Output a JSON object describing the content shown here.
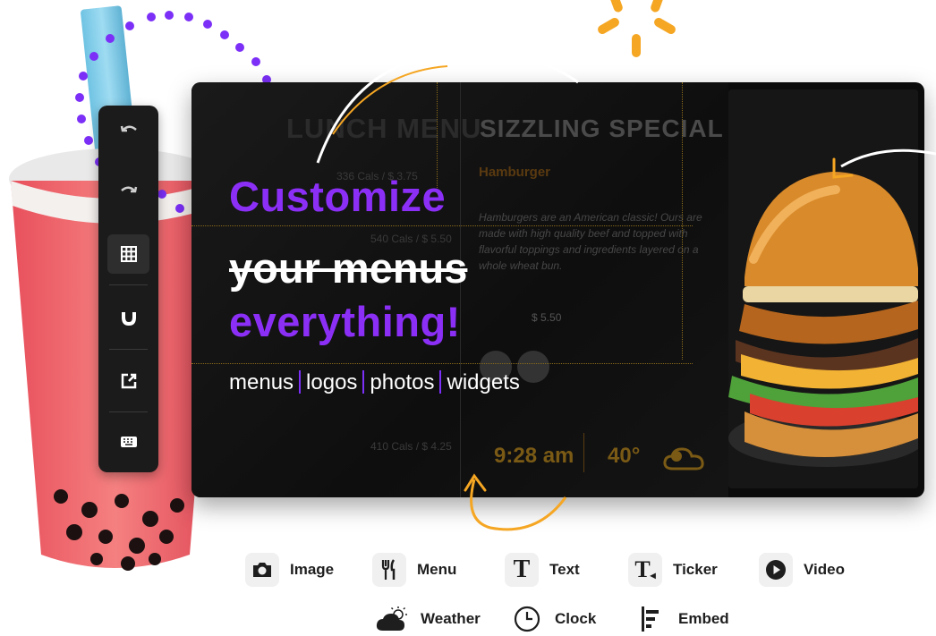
{
  "headline": {
    "line1": "Customize",
    "line2": "your menus",
    "line3": "everything!"
  },
  "features": [
    "menus",
    "logos",
    "photos",
    "widgets"
  ],
  "preview": {
    "lunch_menu_title": "LUNCH MENU",
    "special_title": "SIZZLING SPECIAL",
    "item_name": "Hamburger",
    "item_description": "Hamburgers are an American classic! Ours are made with high quality beef and topped with flavorful toppings and ingredients layered on a whole wheat bun.",
    "item_price": "$ 5.50",
    "menu_rows": [
      {
        "cals": "336 Cals",
        "price": "$ 3.75"
      },
      {
        "cals": "540 Cals",
        "price": "$ 5.50"
      },
      {
        "cals": "410 Cals",
        "price": "$ 4.25"
      }
    ],
    "clock": "9:28 am",
    "temperature": "40°"
  },
  "toolbar": {
    "tools": [
      "undo-icon",
      "redo-icon",
      "grid-icon",
      "magnet-icon",
      "external-link-icon",
      "keyboard-icon"
    ],
    "active": "grid-icon"
  },
  "widgets": [
    {
      "label": "Image",
      "icon": "camera-icon"
    },
    {
      "label": "Menu",
      "icon": "fork-knife-icon"
    },
    {
      "label": "Text",
      "icon": "text-icon"
    },
    {
      "label": "Ticker",
      "icon": "ticker-icon"
    },
    {
      "label": "Video",
      "icon": "play-icon"
    },
    {
      "label": "Weather",
      "icon": "weather-icon"
    },
    {
      "label": "Clock",
      "icon": "clock-icon"
    },
    {
      "label": "Embed",
      "icon": "embed-icon"
    }
  ],
  "colors": {
    "accent_purple": "#8b2ff7",
    "accent_orange": "#f5a623",
    "screen_bg": "#0b0b0b"
  }
}
